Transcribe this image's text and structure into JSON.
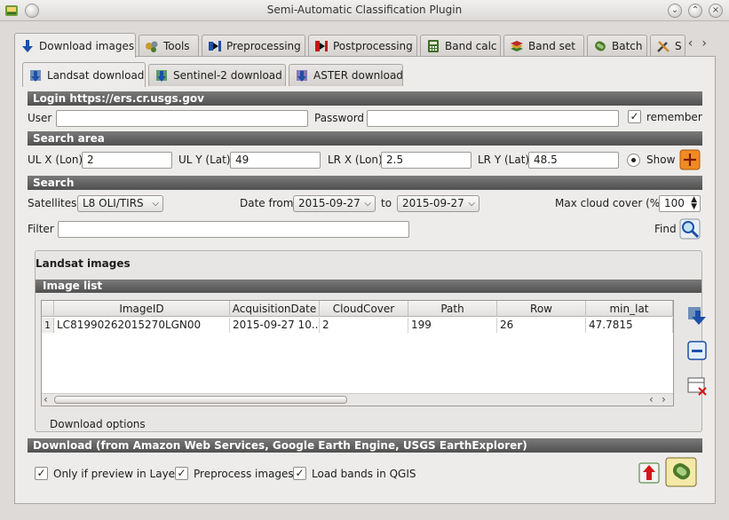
{
  "window": {
    "title": "Semi-Automatic Classification Plugin"
  },
  "main_tabs": [
    {
      "label": "Download images",
      "icon": "download-images-icon"
    },
    {
      "label": "Tools",
      "icon": "tools-icon"
    },
    {
      "label": "Preprocessing",
      "icon": "preprocessing-icon"
    },
    {
      "label": "Postprocessing",
      "icon": "postprocessing-icon"
    },
    {
      "label": "Band calc",
      "icon": "band-calc-icon"
    },
    {
      "label": "Band set",
      "icon": "band-set-icon"
    },
    {
      "label": "Batch",
      "icon": "batch-icon"
    },
    {
      "label": "S",
      "icon": "settings-icon"
    }
  ],
  "sub_tabs": [
    {
      "label": "Landsat download"
    },
    {
      "label": "Sentinel-2 download"
    },
    {
      "label": "ASTER download"
    }
  ],
  "login": {
    "title": "Login https://ers.cr.usgs.gov",
    "user_label": "User",
    "user_value": "",
    "password_label": "Password",
    "password_value": "",
    "remember_label": "remember",
    "remember_checked": true
  },
  "search_area": {
    "title": "Search area",
    "ulx_label": "UL X (Lon)",
    "ulx_value": "2",
    "uly_label": "UL Y (Lat)",
    "uly_value": "49",
    "lrx_label": "LR X (Lon)",
    "lrx_value": "2.5",
    "lry_label": "LR Y (Lat)",
    "lry_value": "48.5",
    "show_label": "Show"
  },
  "search": {
    "title": "Search",
    "satellites_label": "Satellites",
    "satellites_value": "L8 OLI/TIRS",
    "date_from_label": "Date from",
    "date_from_value": "2015-09-27",
    "to_label": "to",
    "date_to_value": "2015-09-27",
    "max_cloud_label": "Max cloud cover (%)",
    "max_cloud_value": "100",
    "filter_label": "Filter",
    "filter_value": "",
    "find_label": "Find"
  },
  "landsat_images": {
    "title": "Landsat images",
    "image_list_title": "Image list",
    "columns": [
      "ImageID",
      "AcquisitionDate",
      "CloudCover",
      "Path",
      "Row",
      "min_lat"
    ],
    "rows": [
      {
        "num": "1",
        "cells": [
          "LC81990262015270LGN00",
          "2015-09-27 10...",
          "2",
          "199",
          "26",
          "47.7815"
        ]
      }
    ],
    "download_options_label": "Download options"
  },
  "download": {
    "title": "Download (from Amazon Web Services, Google Earth Engine, USGS EarthExplorer)",
    "only_preview_label": "Only if preview in Layers",
    "preprocess_label": "Preprocess images",
    "load_bands_label": "Load bands in QGIS"
  },
  "colors": {
    "accent_orange": "#f08a24",
    "section_bar": "#5e5e5e",
    "tab_active": "#edecea"
  }
}
